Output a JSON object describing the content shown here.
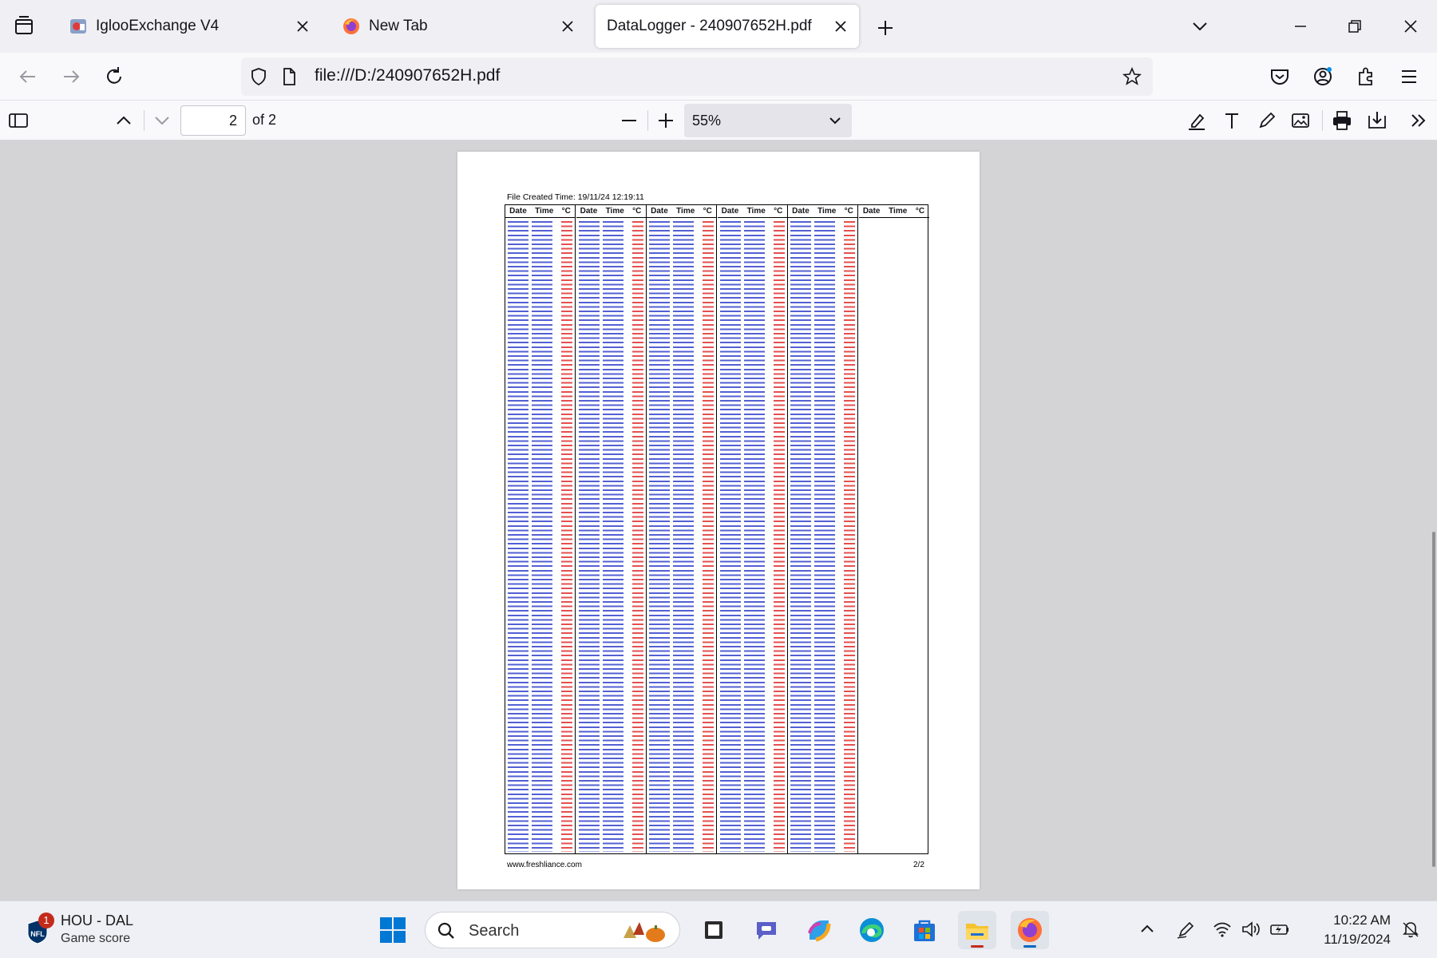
{
  "browser": {
    "tabs": [
      {
        "label": "IglooExchange V4",
        "active": false,
        "favicon": "iglooexchange-favicon"
      },
      {
        "label": "New Tab",
        "active": false,
        "favicon": "firefox-favicon"
      },
      {
        "label": "DataLogger - 240907652H.pdf",
        "active": true,
        "favicon": "none"
      }
    ],
    "url": "file:///D:/240907652H.pdf"
  },
  "pdf_toolbar": {
    "page_number": "2",
    "page_count": "of 2",
    "zoom": "55%"
  },
  "document": {
    "title": "File Created Time: 19/11/24 12:19:11",
    "column_headers": [
      "Date",
      "Time",
      "°C"
    ],
    "column_group_count": 6,
    "footer_left": "www.freshliance.com",
    "footer_right": "2/2",
    "colors": {
      "date_time": "#3344cc",
      "temperature": "#e03030"
    }
  },
  "taskbar": {
    "widget": {
      "title": "HOU - DAL",
      "subtitle": "Game score",
      "badge": "1"
    },
    "search_placeholder": "Search",
    "clock": {
      "time": "10:22 AM",
      "date": "11/19/2024"
    }
  }
}
